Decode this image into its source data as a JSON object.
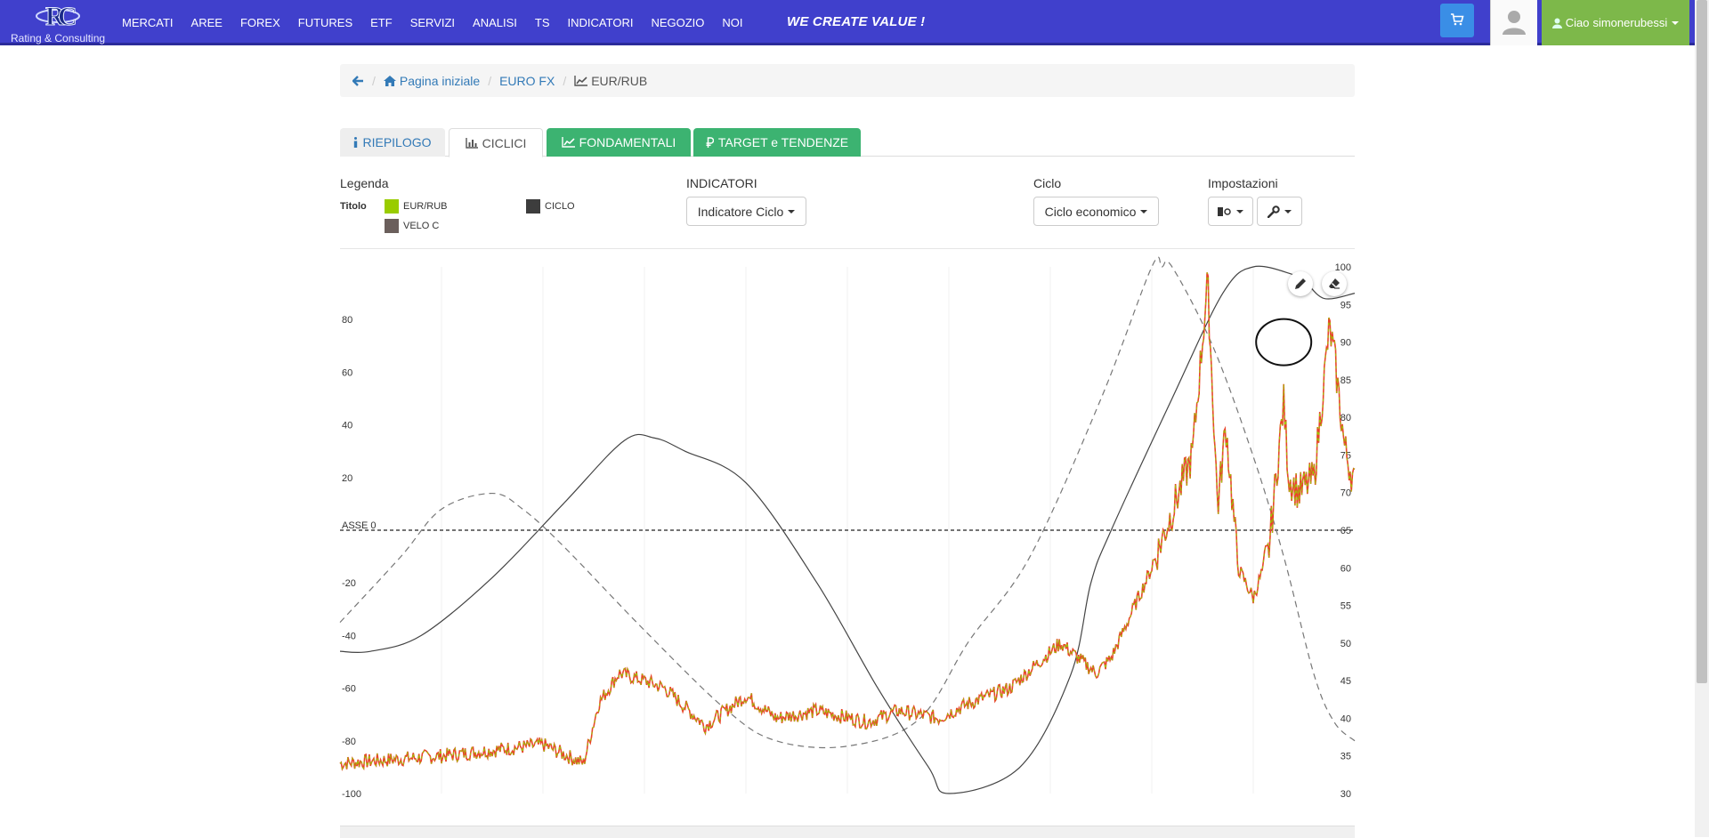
{
  "nav": {
    "logo_text": "Rating & Consulting",
    "items": [
      "MERCATI",
      "AREE",
      "FOREX",
      "FUTURES",
      "ETF",
      "SERVIZI",
      "ANALISI",
      "TS",
      "INDICATORI",
      "NEGOZIO",
      "NOI"
    ],
    "slogan": "WE CREATE VALUE !",
    "greeting_prefix": "Ciao",
    "username": "simonerubessi",
    "brand_color": "#4040cc",
    "user_color": "#7db84a"
  },
  "breadcrumb": {
    "home": "Pagina iniziale",
    "section": "EURO FX",
    "current": "EUR/RUB"
  },
  "tabs": {
    "riepilogo": "RIEPILOGO",
    "ciclici": "CICLICI",
    "fondamentali": "FONDAMENTALI",
    "target": "TARGET e TENDENZE"
  },
  "controls": {
    "legend_label": "Legenda",
    "legend_titolo": "Titolo",
    "legend_items": [
      {
        "name": "EUR/RUB",
        "color": "#99cc00"
      },
      {
        "name": "CICLO",
        "color": "#3d3d3d"
      },
      {
        "name": "VELO C",
        "color": "#6b5f5c"
      }
    ],
    "indicatori_label": "INDICATORI",
    "indicatori_value": "Indicatore Ciclo",
    "ciclo_label": "Ciclo",
    "ciclo_value": "Ciclo economico",
    "impostazioni_label": "Impostazioni"
  },
  "chart_data": {
    "type": "line",
    "axis_zero_label": "ASSE 0",
    "y_left": {
      "ticks": [
        80,
        60,
        40,
        20,
        -20,
        -40,
        -60,
        -80,
        -100
      ],
      "range": [
        -100,
        100
      ]
    },
    "y_right": {
      "ticks": [
        100,
        95,
        90,
        85,
        80,
        75,
        70,
        65,
        60,
        55,
        50,
        45,
        40,
        35,
        30
      ],
      "range": [
        30,
        100
      ]
    },
    "price_series": {
      "name": "EUR/RUB",
      "axis": "right",
      "x": [
        0,
        0.1,
        0.2,
        0.24,
        0.255,
        0.275,
        0.3,
        0.32,
        0.36,
        0.4,
        0.43,
        0.47,
        0.52,
        0.55,
        0.59,
        0.62,
        0.66,
        0.71,
        0.745,
        0.76,
        0.8,
        0.84,
        0.855,
        0.865,
        0.87,
        0.873,
        0.885,
        0.9,
        0.915,
        0.93,
        0.935,
        0.945,
        0.96,
        0.975,
        0.98,
        0.99,
        1.0
      ],
      "y": [
        34,
        35,
        36.5,
        34,
        42,
        46,
        45,
        44,
        39,
        43,
        40,
        41,
        39.5,
        41,
        40,
        42,
        44,
        50,
        46,
        48,
        60,
        75,
        98,
        68,
        75,
        79,
        60,
        56,
        62,
        82,
        72,
        70,
        72,
        92,
        88,
        76,
        71
      ]
    },
    "ciclo_series": {
      "name": "CICLO",
      "axis": "left",
      "x": [
        0,
        0.03,
        0.08,
        0.15,
        0.22,
        0.28,
        0.31,
        0.34,
        0.4,
        0.47,
        0.53,
        0.58,
        0.6,
        0.67,
        0.72,
        0.74,
        0.76,
        0.82,
        0.87,
        0.9,
        0.94,
        0.95,
        0.97,
        1.0
      ],
      "y": [
        -46,
        -46,
        -40,
        -18,
        10,
        34,
        35,
        30,
        18,
        -20,
        -60,
        -90,
        -100,
        -90,
        -55,
        -20,
        0,
        50,
        90,
        100,
        97,
        95,
        88,
        90
      ]
    },
    "velo_series": {
      "name": "VELO C",
      "axis": "left",
      "x": [
        0,
        0.06,
        0.1,
        0.15,
        0.18,
        0.22,
        0.3,
        0.38,
        0.43,
        0.5,
        0.57,
        0.62,
        0.68,
        0.75,
        0.8,
        0.81,
        0.82,
        0.86,
        0.9,
        0.93,
        0.96,
        0.98,
        1.0
      ],
      "y": [
        -35,
        -10,
        8,
        14,
        8,
        -6,
        -38,
        -68,
        -80,
        -82,
        -72,
        -42,
        -10,
        50,
        100,
        100,
        100,
        70,
        28,
        -10,
        -55,
        -73,
        -80
      ]
    },
    "annotation": {
      "type": "circle",
      "x": 0.93,
      "y": 90,
      "axis": "right"
    },
    "grid": true
  }
}
